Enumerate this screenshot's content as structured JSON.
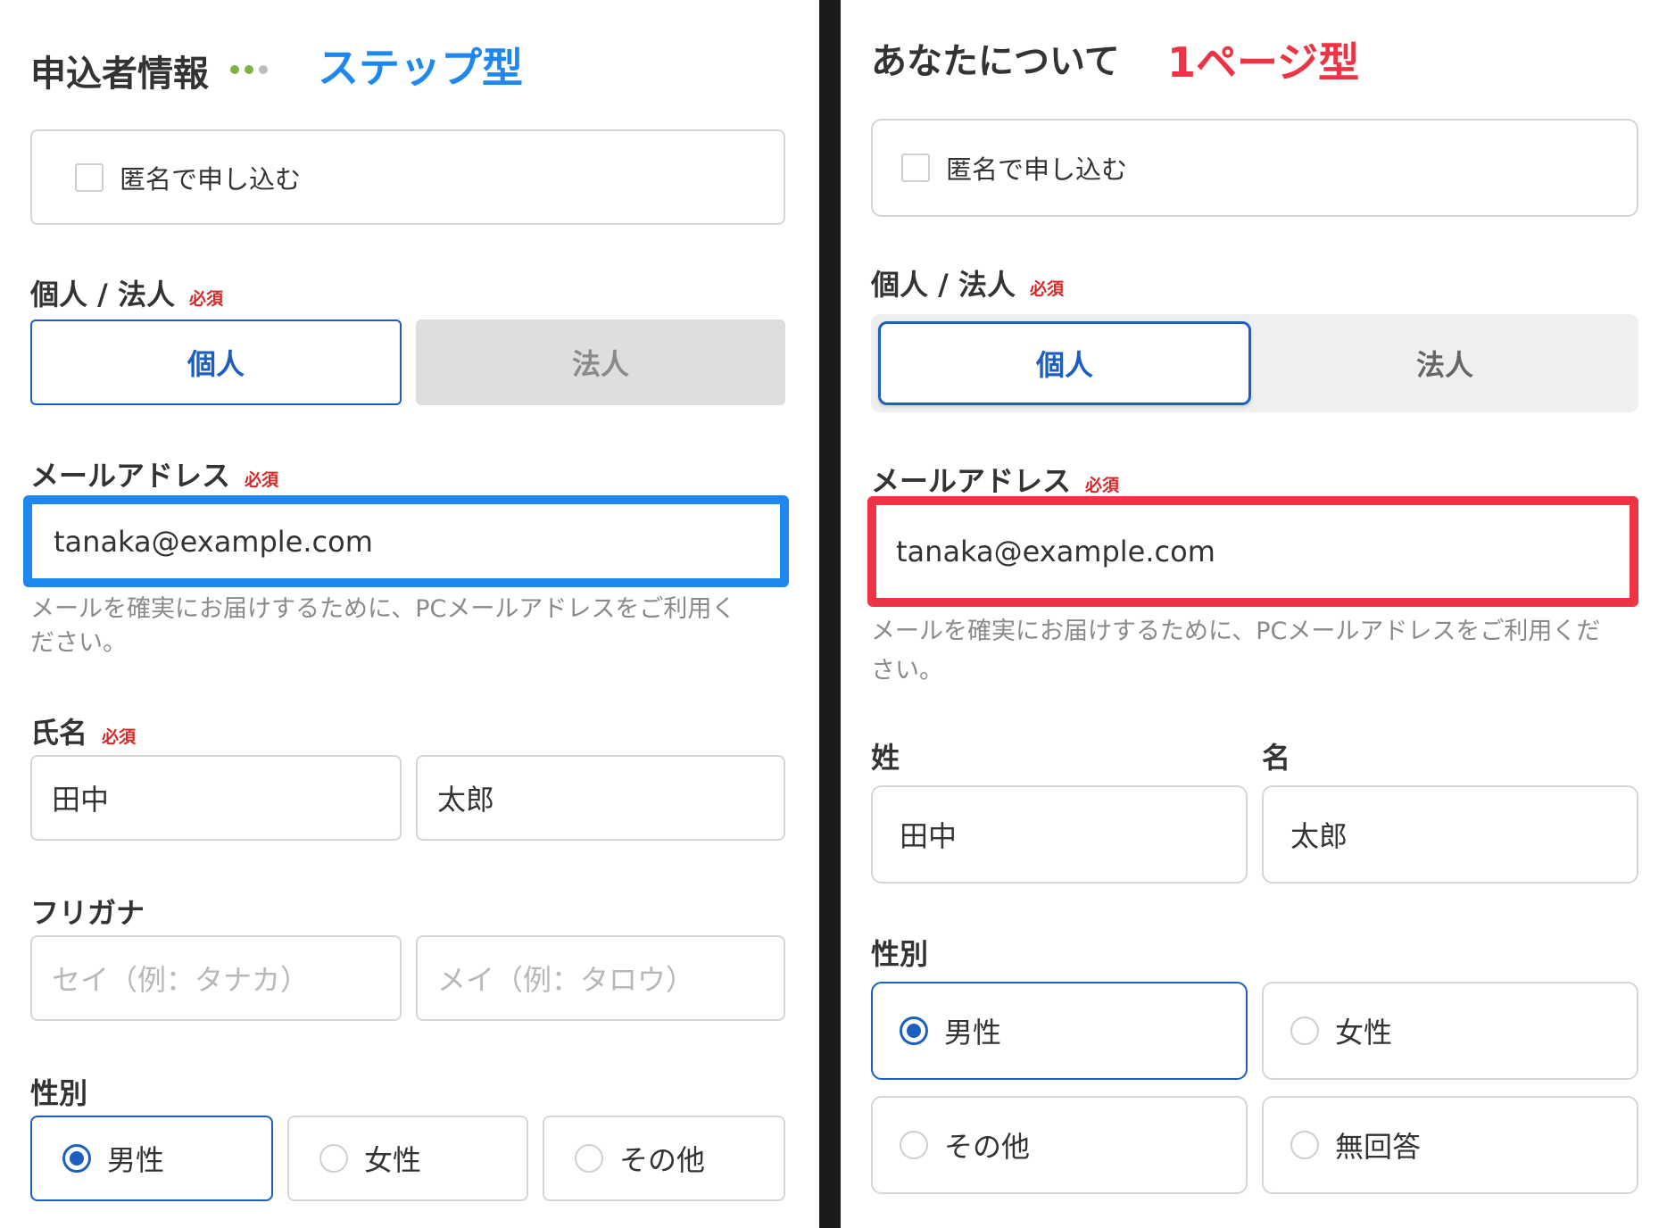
{
  "left": {
    "title": "申込者情報",
    "overlay": "ステップ型",
    "anonymous_label": "匿名で申し込む",
    "type_label": "個人 / 法人",
    "required": "必須",
    "type_options": [
      "個人",
      "法人"
    ],
    "email_label": "メールアドレス",
    "email_value": "tanaka@example.com",
    "email_help_1": "メールを確実にお届けするために、PCメールアドレスをご利用く",
    "email_help_2": "ださい。",
    "name_label": "氏名",
    "last_name": "田中",
    "first_name": "太郎",
    "furigana_label": "フリガナ",
    "furigana_sei_placeholder": "セイ（例：タナカ）",
    "furigana_mei_placeholder": "メイ（例：タロウ）",
    "gender_label": "性別",
    "gender_options": [
      "男性",
      "女性",
      "その他"
    ]
  },
  "right": {
    "title": "あなたについて",
    "overlay": "1ページ型",
    "anonymous_label": "匿名で申し込む",
    "type_label": "個人 / 法人",
    "required": "必須",
    "type_options": [
      "個人",
      "法人"
    ],
    "email_label": "メールアドレス",
    "email_value": "tanaka@example.com",
    "email_help_1": "メールを確実にお届けするために、PCメールアドレスをご利用くだ",
    "email_help_2": "さい。",
    "last_name_label": "姓",
    "first_name_label": "名",
    "last_name": "田中",
    "first_name": "太郎",
    "gender_label": "性別",
    "gender_options": [
      "男性",
      "女性",
      "その他",
      "無回答"
    ]
  },
  "colors": {
    "step_accent": "#1e88f0",
    "page_accent": "#ee3344",
    "selected": "#1c5fbf",
    "required": "#d62828",
    "progress_dot": "#7cb342"
  },
  "progress": {
    "current_step": 2,
    "total_steps": 3
  }
}
